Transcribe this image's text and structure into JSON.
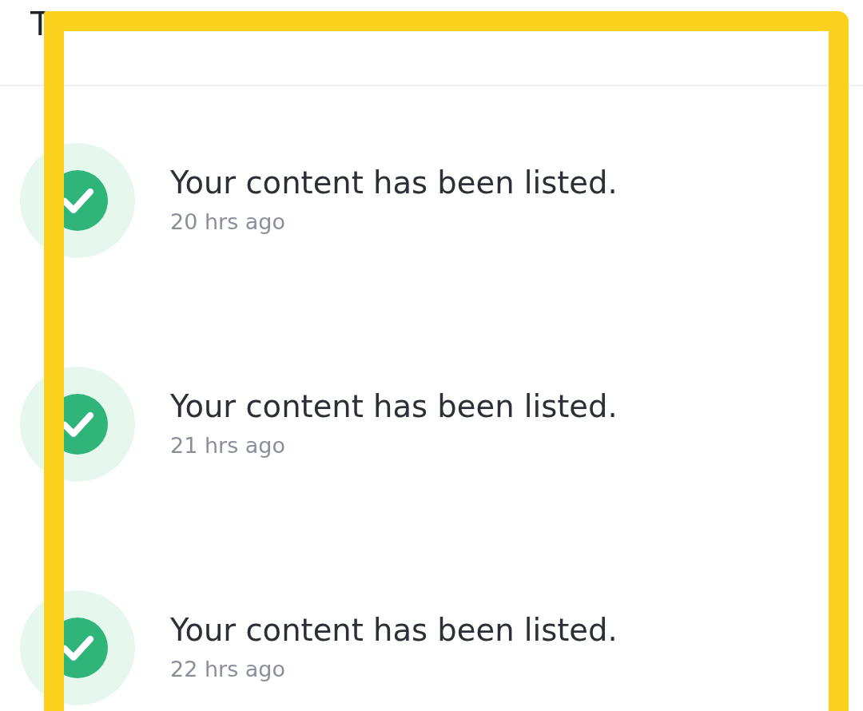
{
  "header": {
    "title": "T"
  },
  "notifications": [
    {
      "title": "Your content has been listed.",
      "time": "20 hrs ago"
    },
    {
      "title": "Your content has been listed.",
      "time": "21 hrs ago"
    },
    {
      "title": "Your content has been listed.",
      "time": "22 hrs ago"
    }
  ]
}
